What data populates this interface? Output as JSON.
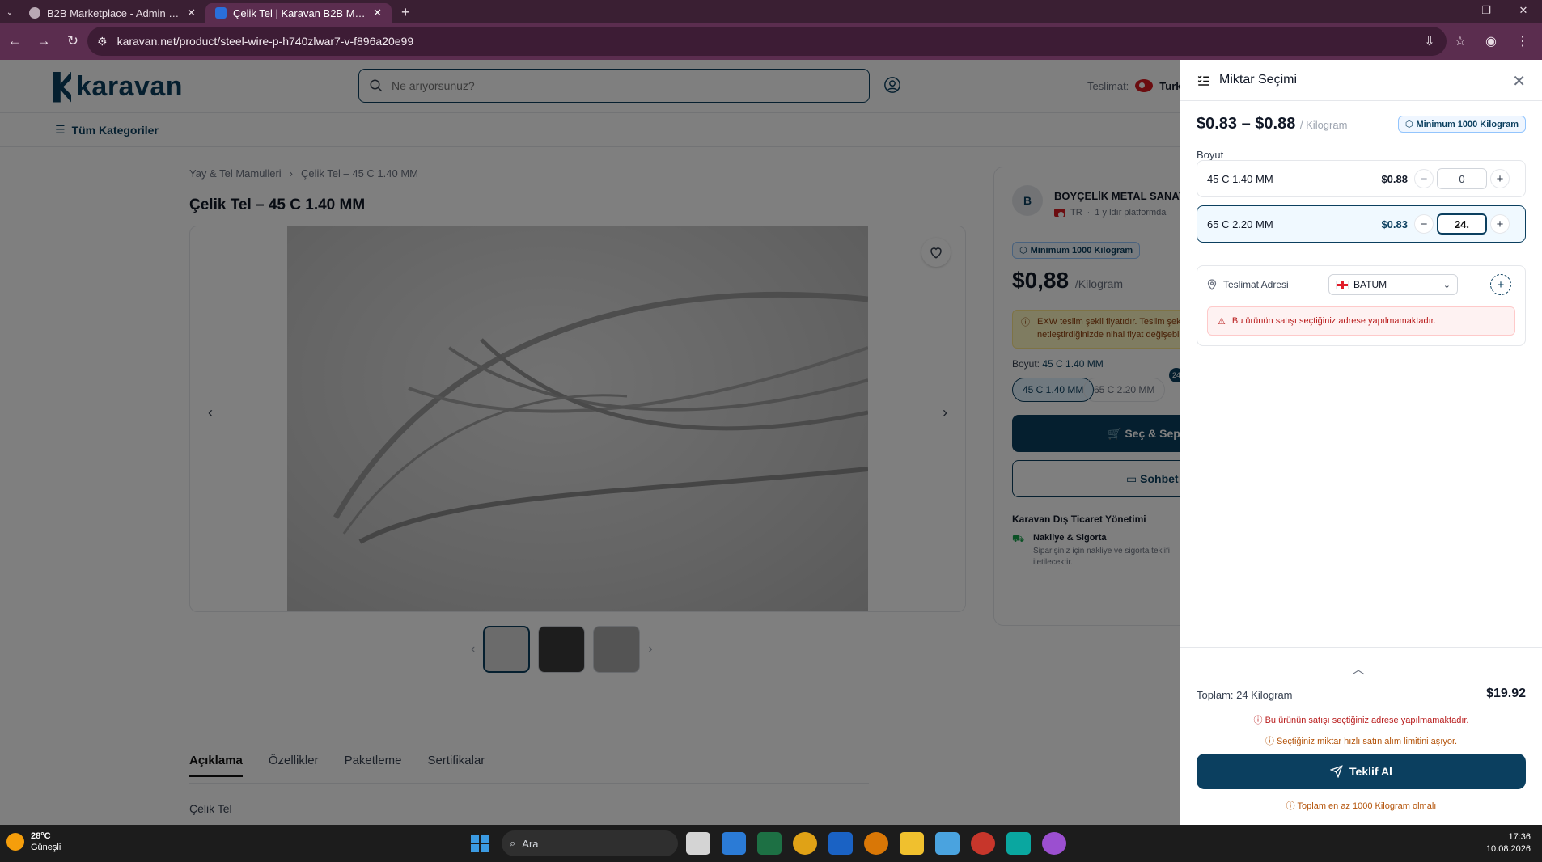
{
  "browser": {
    "tabs": [
      {
        "title": "B2B Marketplace - Admin Panel",
        "active": false
      },
      {
        "title": "Çelik Tel | Karavan B2B Marketp",
        "active": true
      }
    ],
    "url": "karavan.net/product/steel-wire-p-h740zlwar7-v-f896a20e99"
  },
  "site": {
    "logo_text": "karavan",
    "search_placeholder": "Ne arıyorsunuz?",
    "delivery_label": "Teslimat:",
    "delivery_country": "Turk",
    "categories_label": "Tüm Kategoriler",
    "breadcrumb": [
      "Yay & Tel Mamulleri",
      "Çelik Tel – 45 C 1.40 MM"
    ],
    "product_title": "Çelik Tel – 45 C 1.40 MM",
    "detail_tabs": [
      "Açıklama",
      "Özellikler",
      "Paketleme",
      "Sertifikalar"
    ],
    "description": "Çelik Tel"
  },
  "seller": {
    "avatar_letter": "B",
    "name": "BOYÇELİK METAL SANAYİ",
    "country": "TR",
    "platform_age": "1 yıldır platformda",
    "min_badge": "Minimum 1000 Kilogram",
    "price": "$0,88",
    "price_unit": "/Kilogram",
    "warning_line1": "EXW teslim şekli fiyatıdır. Teslim şekli",
    "warning_line2": "netleştirdiğinizde nihai fiyat değişebilir",
    "size_label": "Boyut:",
    "size_value": "45 C 1.40 MM",
    "size_chips": [
      "45 C 1.40 MM",
      "65 C 2.20 MM"
    ],
    "chip_count": "24",
    "buy_button": "Seç & Sepete Ekle",
    "chat_button": "Sohbet",
    "trade_title": "Karavan Dış Ticaret Yönetimi",
    "shipping_title": "Nakliye & Sigorta",
    "shipping_text": "Siparişiniz için nakliye ve sigorta teklifi iletilecektir."
  },
  "drawer": {
    "title": "Miktar Seçimi",
    "price_range": "$0.83 – $0.88",
    "price_unit": "/ Kilogram",
    "min_badge": "Minimum 1000 Kilogram",
    "size_label": "Boyut",
    "variants": [
      {
        "name": "45 C 1.40 MM",
        "price": "$0.88",
        "qty": "0"
      },
      {
        "name": "65 C 2.20 MM",
        "price": "$0.83",
        "qty": "24."
      }
    ],
    "address_label": "Teslimat Adresi",
    "address_value": "BATUM",
    "address_error": "Bu ürünün satışı seçtiğiniz adrese yapılmamaktadır.",
    "total_label": "Toplam: 24 Kilogram",
    "total_value": "$19.92",
    "msg_address": "Bu ürünün satışı seçtiğiniz adrese yapılmamaktadır.",
    "msg_limit": "Seçtiğiniz miktar hızlı satın alım limitini aşıyor.",
    "quote_button": "Teklif Al",
    "msg_minimum": "Toplam en az 1000 Kilogram olmalı"
  },
  "taskbar": {
    "temp": "28°C",
    "weather": "Güneşli",
    "search": "Ara",
    "time": "17:36",
    "date": "10.08.2026"
  }
}
